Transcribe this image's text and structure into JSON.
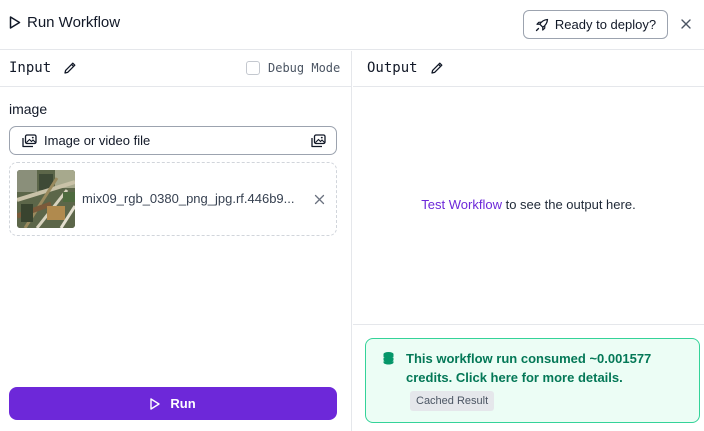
{
  "header": {
    "title": "Run Workflow",
    "deploy_label": "Ready to deploy?",
    "icons": {
      "title": "play-outline-icon",
      "deploy": "rocket-icon",
      "close": "close-icon"
    }
  },
  "input_panel": {
    "heading": "Input",
    "debug_label": "Debug Mode",
    "debug_checked": false,
    "field_label": "image",
    "file_button_label": "Image or video file",
    "file_name": "mix09_rgb_0380_png_jpg.rf.446b9...",
    "run_label": "Run"
  },
  "output_panel": {
    "heading": "Output",
    "link_text": "Test Workflow",
    "message_rest": " to see the output here."
  },
  "credits": {
    "message": "This workflow run consumed ~0.001577 credits. Click here for more details.",
    "badge": "Cached Result"
  },
  "colors": {
    "accent": "#6d28d9",
    "success_bg": "#ecfdf5",
    "success_border": "#34d399",
    "success_text": "#047857",
    "border": "#e5e7eb"
  }
}
